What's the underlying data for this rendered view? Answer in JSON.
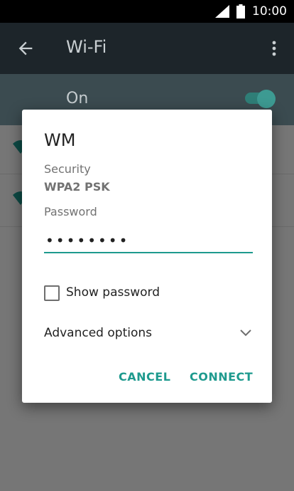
{
  "status_bar": {
    "time": "10:00"
  },
  "app_bar": {
    "title": "Wi-Fi"
  },
  "toggle": {
    "label": "On",
    "state": "on"
  },
  "dialog": {
    "title": "WM",
    "security_label": "Security",
    "security_value": "WPA2 PSK",
    "password_label": "Password",
    "password_value": "12345678",
    "show_password_label": "Show password",
    "show_password_checked": false,
    "advanced_label": "Advanced options",
    "cancel_label": "CANCEL",
    "connect_label": "CONNECT"
  },
  "colors": {
    "accent": "#1e9a8e",
    "app_bar_bg": "#1d252a",
    "toggle_row_bg": "#3b4b50",
    "scrim": "#767676"
  },
  "icons": [
    "signal-icon",
    "battery-icon",
    "back-arrow-icon",
    "overflow-menu-icon",
    "wifi-icon",
    "chevron-down-icon"
  ]
}
